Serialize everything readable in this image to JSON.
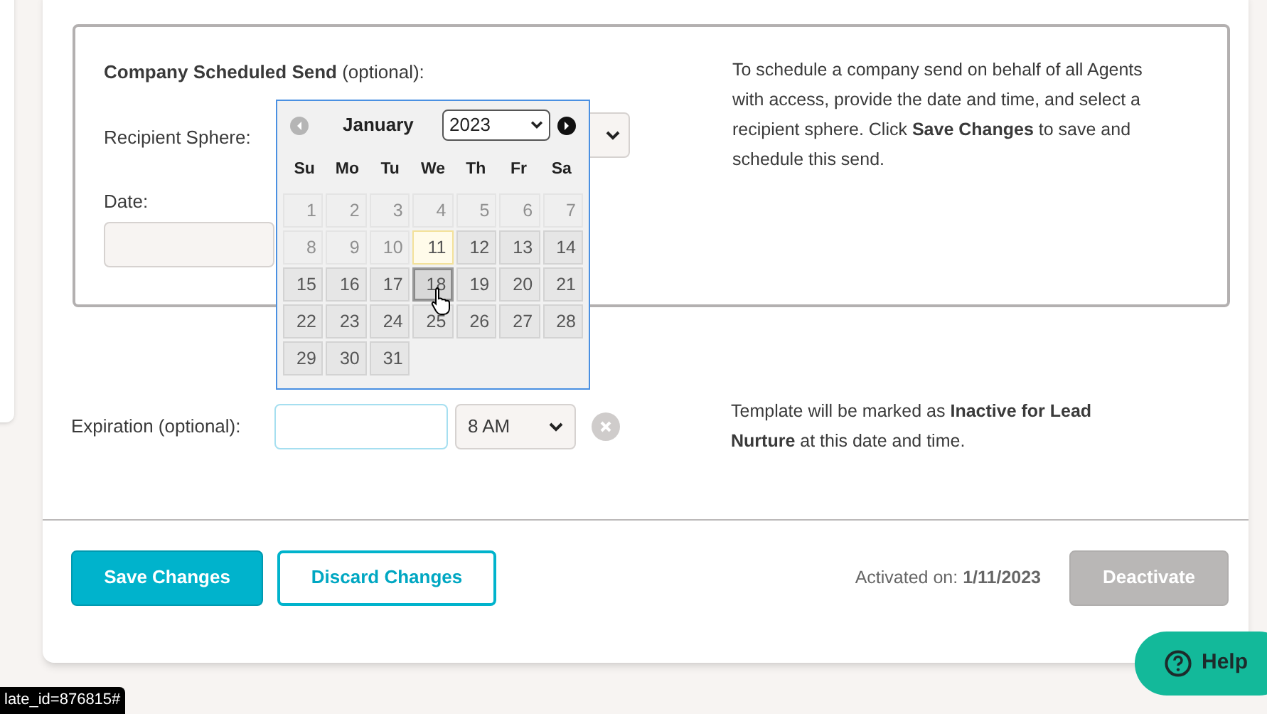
{
  "scheduled_send": {
    "title": "Company Scheduled Send",
    "title_note": "(optional):",
    "recipient_label": "Recipient Sphere:",
    "date_label": "Date:",
    "help_text": "To schedule a company send on behalf of all Agents with access, provide the date and time, and select a recipient sphere. Click **Save Changes** to save and schedule this send."
  },
  "datepicker": {
    "month": "January",
    "year": "2023",
    "weekdays": [
      "Su",
      "Mo",
      "Tu",
      "We",
      "Th",
      "Fr",
      "Sa"
    ],
    "days": [
      {
        "label": "1",
        "disabled": true,
        "today": false,
        "hovered": false
      },
      {
        "label": "2",
        "disabled": true,
        "today": false,
        "hovered": false
      },
      {
        "label": "3",
        "disabled": true,
        "today": false,
        "hovered": false
      },
      {
        "label": "4",
        "disabled": true,
        "today": false,
        "hovered": false
      },
      {
        "label": "5",
        "disabled": true,
        "today": false,
        "hovered": false
      },
      {
        "label": "6",
        "disabled": true,
        "today": false,
        "hovered": false
      },
      {
        "label": "7",
        "disabled": true,
        "today": false,
        "hovered": false
      },
      {
        "label": "8",
        "disabled": true,
        "today": false,
        "hovered": false
      },
      {
        "label": "9",
        "disabled": true,
        "today": false,
        "hovered": false
      },
      {
        "label": "10",
        "disabled": true,
        "today": false,
        "hovered": false
      },
      {
        "label": "11",
        "disabled": false,
        "today": true,
        "hovered": false
      },
      {
        "label": "12",
        "disabled": false,
        "today": false,
        "hovered": false
      },
      {
        "label": "13",
        "disabled": false,
        "today": false,
        "hovered": false
      },
      {
        "label": "14",
        "disabled": false,
        "today": false,
        "hovered": false
      },
      {
        "label": "15",
        "disabled": false,
        "today": false,
        "hovered": false
      },
      {
        "label": "16",
        "disabled": false,
        "today": false,
        "hovered": false
      },
      {
        "label": "17",
        "disabled": false,
        "today": false,
        "hovered": false
      },
      {
        "label": "18",
        "disabled": false,
        "today": false,
        "hovered": true
      },
      {
        "label": "19",
        "disabled": false,
        "today": false,
        "hovered": false
      },
      {
        "label": "20",
        "disabled": false,
        "today": false,
        "hovered": false
      },
      {
        "label": "21",
        "disabled": false,
        "today": false,
        "hovered": false
      },
      {
        "label": "22",
        "disabled": false,
        "today": false,
        "hovered": false
      },
      {
        "label": "23",
        "disabled": false,
        "today": false,
        "hovered": false
      },
      {
        "label": "24",
        "disabled": false,
        "today": false,
        "hovered": false
      },
      {
        "label": "25",
        "disabled": false,
        "today": false,
        "hovered": false
      },
      {
        "label": "26",
        "disabled": false,
        "today": false,
        "hovered": false
      },
      {
        "label": "27",
        "disabled": false,
        "today": false,
        "hovered": false
      },
      {
        "label": "28",
        "disabled": false,
        "today": false,
        "hovered": false
      },
      {
        "label": "29",
        "disabled": false,
        "today": false,
        "hovered": false
      },
      {
        "label": "30",
        "disabled": false,
        "today": false,
        "hovered": false
      },
      {
        "label": "31",
        "disabled": false,
        "today": false,
        "hovered": false
      }
    ]
  },
  "expiration": {
    "label": "Expiration (optional):",
    "time": "8 AM",
    "help_text": "Template will be marked as **Inactive for Lead Nurture** at this date and time."
  },
  "footer": {
    "save": "Save Changes",
    "discard": "Discard Changes",
    "activated": "Activated on: **1/11/2023**",
    "deactivate": {
      "label": "Deactivate",
      "disabled": true
    }
  },
  "help_button": "Help",
  "status_url": "late_id=876815#"
}
